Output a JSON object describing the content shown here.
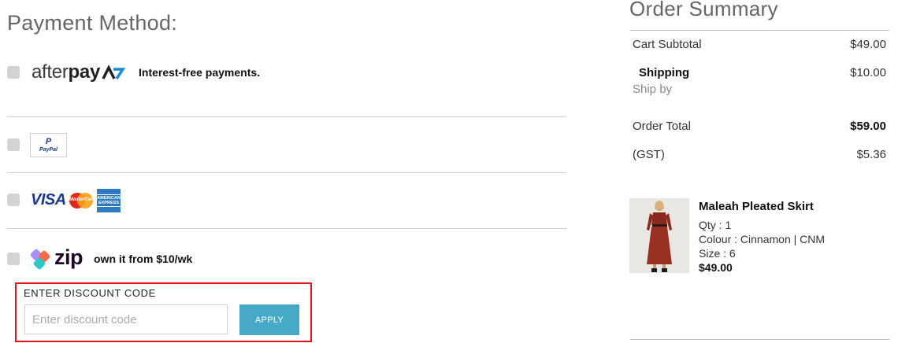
{
  "payment": {
    "title": "Payment Method:",
    "options": [
      {
        "id": "afterpay",
        "caption": "Interest-free payments."
      },
      {
        "id": "paypal",
        "logo_text": "PayPal"
      },
      {
        "id": "cards",
        "visa_text": "VISA",
        "mastercard_text": "MasterCard",
        "amex_text": "AMERICAN EXPRESS"
      },
      {
        "id": "zip",
        "caption": "own it from $10/wk"
      }
    ],
    "afterpay_logo_light": "after",
    "afterpay_logo_bold": "pay",
    "zip_logo_text": "zip"
  },
  "discount": {
    "label": "ENTER DISCOUNT CODE",
    "placeholder": "Enter discount code",
    "apply_label": "APPLY"
  },
  "summary": {
    "title": "Order Summary",
    "cart_subtotal_label": "Cart Subtotal",
    "cart_subtotal_value": "$49.00",
    "shipping_label": "Shipping",
    "shipping_value": "$10.00",
    "ship_by_label": "Ship by",
    "order_total_label": "Order Total",
    "order_total_value": "$59.00",
    "gst_label": "(GST)",
    "gst_value": "$5.36"
  },
  "product": {
    "name": "Maleah Pleated Skirt",
    "qty": "Qty : 1",
    "colour": "Colour : Cinnamon | CNM",
    "size": "Size : 6",
    "price": "$49.00"
  },
  "colors": {
    "accent_button": "#46a9c6",
    "highlight_border": "#e3141b"
  }
}
